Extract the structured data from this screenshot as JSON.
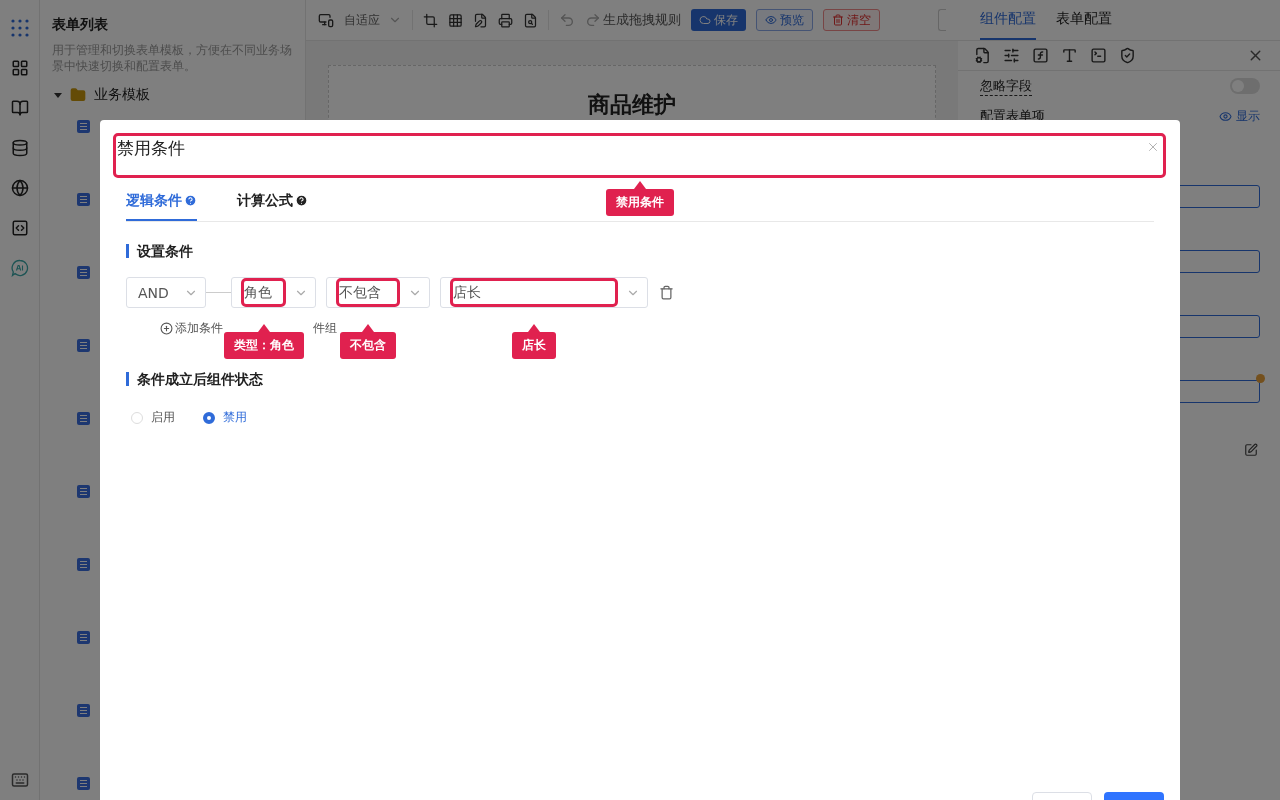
{
  "rail": {
    "items": [
      {
        "kind": "apps",
        "selected": true
      },
      {
        "kind": "grid",
        "selected": false
      },
      {
        "kind": "book",
        "selected": false
      },
      {
        "kind": "database",
        "selected": false
      },
      {
        "kind": "globe",
        "selected": false
      },
      {
        "kind": "code",
        "selected": false
      },
      {
        "kind": "ai",
        "selected": false
      }
    ],
    "bottom": {
      "kind": "keyboard"
    }
  },
  "sidebar": {
    "title": "表单列表",
    "description": "用于管理和切换表单模板，方便在不同业务场景中快速切换和配置表单。",
    "tree": {
      "label": "业务模板",
      "expanded": true,
      "children": [
        {
          "kind": "form"
        },
        {
          "kind": "form"
        },
        {
          "kind": "form"
        },
        {
          "kind": "form"
        },
        {
          "kind": "form"
        },
        {
          "kind": "form"
        },
        {
          "kind": "form"
        },
        {
          "kind": "form"
        },
        {
          "kind": "form"
        },
        {
          "kind": "form"
        }
      ]
    }
  },
  "toolbar": {
    "layout_select": "自适应",
    "generate_rules": "生成拖拽规则",
    "buttons": [
      {
        "kind": "primary",
        "label": "保存"
      },
      {
        "kind": "outline",
        "label": "预览"
      },
      {
        "kind": "danger",
        "label": "清空"
      }
    ]
  },
  "canvas": {
    "title": "商品维护"
  },
  "right_panel": {
    "tabs": [
      {
        "label": "组件配置",
        "selected": true
      },
      {
        "label": "表单配置",
        "selected": false
      }
    ],
    "ignore_field": {
      "label": "忽略字段",
      "on": false
    },
    "form_items": {
      "label": "配置表单项",
      "visibility": "显示"
    },
    "fields": [
      {
        "marked": false
      },
      {
        "marked": false
      },
      {
        "marked": false
      },
      {
        "marked": true
      }
    ]
  },
  "dialog": {
    "title": "禁用条件",
    "title_callout": "禁用条件",
    "tabs": [
      {
        "label": "逻辑条件",
        "selected": true
      },
      {
        "label": "计算公式",
        "selected": false
      }
    ],
    "conditions_section": "设置条件",
    "condition": {
      "logic": "AND",
      "selects": [
        {
          "value": "角色",
          "callout": "类型：角色"
        },
        {
          "value": "不包含",
          "callout": "不包含"
        },
        {
          "value": "店长",
          "callout": "店长"
        }
      ]
    },
    "add_condition": "添加条件",
    "add_group": "件组",
    "state_section": "条件成立后组件状态",
    "states": [
      {
        "label": "启用",
        "selected": false
      },
      {
        "label": "禁用",
        "selected": true
      }
    ],
    "footer_buttons": [
      {
        "kind": "secondary"
      },
      {
        "kind": "primary"
      }
    ]
  }
}
